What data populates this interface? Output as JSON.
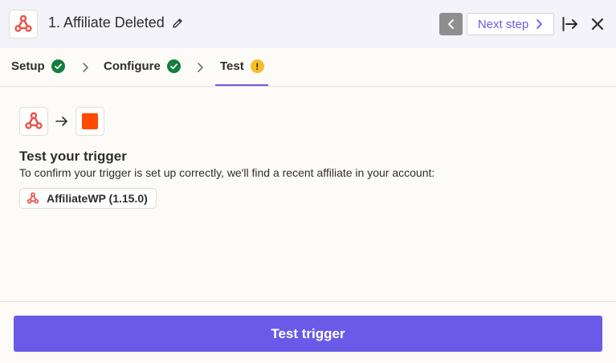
{
  "header": {
    "step_title": "1. Affiliate Deleted",
    "next_step_label": "Next step",
    "app_icon": "affiliatewp-logo-icon",
    "edit_icon": "pencil-icon",
    "prev_icon": "chevron-left-icon",
    "next_icon": "chevron-right-icon",
    "expand_icon": "arrow-to-right-icon",
    "close_icon": "close-icon"
  },
  "tabs": [
    {
      "label": "Setup",
      "status": "complete",
      "status_icon": "check-circle-icon"
    },
    {
      "label": "Configure",
      "status": "complete",
      "status_icon": "check-circle-icon"
    },
    {
      "label": "Test",
      "status": "warning",
      "status_icon": "warning-circle-icon",
      "warning_glyph": "!"
    }
  ],
  "active_tab": "Test",
  "main": {
    "flow": {
      "source_icon": "affiliatewp-logo-icon",
      "arrow_icon": "arrow-right-icon",
      "target_icon": "zapier-orange-square-icon"
    },
    "title": "Test your trigger",
    "description": "To confirm your trigger is set up correctly, we'll find a recent affiliate in your account:",
    "app_chip": {
      "label": "AffiliateWP (1.15.0)",
      "icon": "affiliatewp-logo-icon"
    }
  },
  "footer": {
    "primary_button_label": "Test trigger"
  },
  "colors": {
    "accent": "#695be8",
    "success": "#137e3f",
    "warning": "#f6bd27",
    "brand_orange": "#ff4a00",
    "logo_red": "#e8564b",
    "header_bg": "#f4f3fa",
    "page_bg": "#fdfbf7"
  }
}
